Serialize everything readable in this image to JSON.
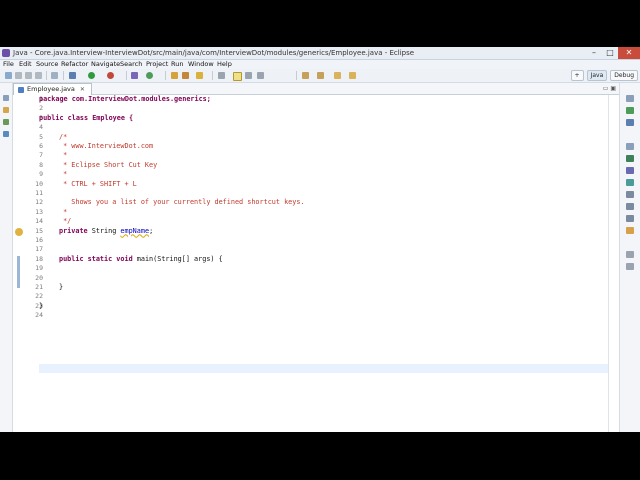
{
  "window": {
    "title": "Java - Core.java.Interview-InterviewDot/src/main/java/com/InterviewDot/modules/generics/Employee.java - Eclipse"
  },
  "menu": [
    "File",
    "Edit",
    "Source",
    "Refactor",
    "Navigate",
    "Search",
    "Project",
    "Run",
    "Window",
    "Help"
  ],
  "perspectives": {
    "java": "Java",
    "debug": "Debug"
  },
  "editor_tab": {
    "label": "Employee.java"
  },
  "code": {
    "line_numbers": [
      "1",
      "2",
      "3",
      "4",
      "5",
      "6",
      "7",
      "8",
      "9",
      "10",
      "11",
      "12",
      "13",
      "14",
      "15",
      "16",
      "17",
      "18",
      "19",
      "20",
      "21",
      "22",
      "23",
      "24"
    ],
    "l1": "package com.InterviewDot.modules.generics;",
    "l3": "public class Employee {",
    "l5": "/*",
    "l6": " * www.InterviewDot.com",
    "l7": " *",
    "l8": " * Eclipse Short Cut Key",
    "l9": " *",
    "l10": " * CTRL + SHIFT + L",
    "l12": "   Shows you a list of your currently defined shortcut keys.",
    "l13": " *",
    "l14": " */",
    "l15_kw": "private",
    "l15_type": " String ",
    "l15_field": "empName",
    "l15_end": ";",
    "l18_kw": "public static void",
    "l18_rest": " main(String[] args) {",
    "l21": "}",
    "l23": "}"
  }
}
